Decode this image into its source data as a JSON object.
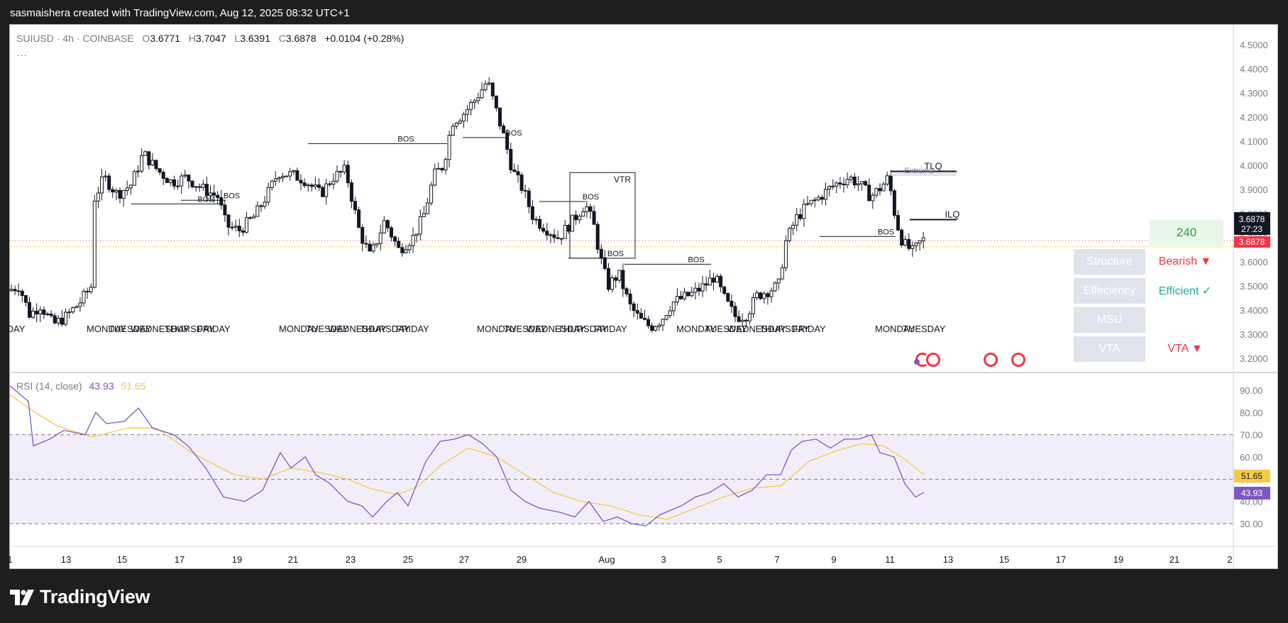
{
  "header": {
    "attribution": "sasmaishera created with TradingView.com, Aug 12, 2025 08:32 UTC+1"
  },
  "legend": {
    "symbol": "SUIUSD · 4h · COINBASE",
    "open_label": "O",
    "open": "3.6771",
    "high_label": "H",
    "high": "3.7047",
    "low_label": "L",
    "low": "3.6391",
    "close_label": "C",
    "close": "3.6878",
    "change": "+0.0104 (+0.28%)",
    "more": "..."
  },
  "rsi_legend": {
    "label": "RSI (14, close)",
    "rsi": "43.93",
    "ma": "51.65"
  },
  "price_badge": {
    "price": "3.6878",
    "countdown": "27:23",
    "close": "3.6878"
  },
  "rsi_badges": {
    "ma": "51.65",
    "rsi": "43.93"
  },
  "panel": {
    "timeframe": "240",
    "rows": [
      {
        "label": "Structure",
        "value": "Bearish ▼",
        "color": "#f23645"
      },
      {
        "label": "Effeciency",
        "value": "Efficient ✓",
        "color": "#22ab94"
      },
      {
        "label": "MSU",
        "value": "",
        "color": "#22ab94"
      },
      {
        "label": "VTA",
        "value": "VTA ▼",
        "color": "#f23645"
      }
    ]
  },
  "footer": {
    "brand": "TradingView"
  },
  "chart_data": [
    {
      "type": "candlestick",
      "title": "SUIUSD · 4h · COINBASE",
      "ylim": [
        3.15,
        4.55
      ],
      "yticks": [
        "4.5000",
        "4.4000",
        "4.3000",
        "4.2000",
        "4.1000",
        "4.0000",
        "3.9000",
        "3.8000",
        "3.7000",
        "3.6000",
        "3.5000",
        "3.4000",
        "3.3000",
        "3.2000"
      ],
      "xticks": [
        "1",
        "13",
        "15",
        "17",
        "19",
        "21",
        "23",
        "25",
        "27",
        "29",
        "Aug",
        "3",
        "5",
        "7",
        "9",
        "11",
        "13",
        "15",
        "17",
        "19",
        "21",
        "2"
      ],
      "day_labels": [
        {
          "x": 6,
          "t": "IDAY"
        },
        {
          "x": 122,
          "t": "MONDAY"
        },
        {
          "x": 153,
          "t": "TUESDAY"
        },
        {
          "x": 184,
          "t": "WEDNESDAY"
        },
        {
          "x": 232,
          "t": "THURSDAY"
        },
        {
          "x": 278,
          "t": "FRIDAY"
        },
        {
          "x": 393,
          "t": "MONDAY"
        },
        {
          "x": 431,
          "t": "TUESDAY"
        },
        {
          "x": 462,
          "t": "WEDNESDAY"
        },
        {
          "x": 507,
          "t": "THURSDAY"
        },
        {
          "x": 558,
          "t": "FRIDAY"
        },
        {
          "x": 672,
          "t": "MONDAY"
        },
        {
          "x": 710,
          "t": "TUESDAY"
        },
        {
          "x": 742,
          "t": "WEDNESDAY"
        },
        {
          "x": 786,
          "t": "THURSDAY"
        },
        {
          "x": 837,
          "t": "FRIDAY"
        },
        {
          "x": 953,
          "t": "MONDAY"
        },
        {
          "x": 993,
          "t": "TUESDAY"
        },
        {
          "x": 1025,
          "t": "WEDNESDAY"
        },
        {
          "x": 1070,
          "t": "THURSDAY"
        },
        {
          "x": 1117,
          "t": "FRIDAY"
        },
        {
          "x": 1233,
          "t": "MONDAY"
        },
        {
          "x": 1272,
          "t": "TUESDAY"
        }
      ],
      "annotations": [
        {
          "type": "bos",
          "label": "BOS",
          "x1": 185,
          "x2": 315,
          "price": 3.84
        },
        {
          "type": "bos",
          "label": "BOS",
          "x1": 255,
          "x2": 318,
          "price": 3.855
        },
        {
          "type": "bos",
          "label": "BOS",
          "x1": 434,
          "x2": 630,
          "price": 4.09
        },
        {
          "type": "bos",
          "label": "BOS",
          "x1": 652,
          "x2": 716,
          "price": 4.115
        },
        {
          "type": "bos",
          "label": "BOS",
          "x1": 760,
          "x2": 825,
          "price": 3.85
        },
        {
          "type": "bos",
          "label": "BOS",
          "x1": 801,
          "x2": 854,
          "price": 3.615
        },
        {
          "type": "bos",
          "label": "BOS",
          "x1": 880,
          "x2": 1002,
          "price": 3.59
        },
        {
          "type": "bos",
          "label": "BOS",
          "x1": 1155,
          "x2": 1262,
          "price": 3.705
        },
        {
          "type": "vtr",
          "label": "VTR",
          "x1": 803,
          "x2": 895,
          "p_top": 3.97,
          "p_bot": 3.615
        },
        {
          "type": "line",
          "label": "TLQ",
          "x1": 1255,
          "x2": 1348,
          "price": 3.975
        },
        {
          "type": "zone",
          "label": "Extreme",
          "x1": 1255,
          "x2": 1348,
          "p_top": 3.97,
          "p_bot": 3.96
        },
        {
          "type": "line",
          "label": "ILQ",
          "x1": 1282,
          "x2": 1348,
          "price": 3.775
        }
      ],
      "last_price": 3.6878
    },
    {
      "type": "line",
      "title": "RSI (14, close)",
      "ylim": [
        25,
        95
      ],
      "yticks": [
        "90.00",
        "80.00",
        "70.00",
        "60.00",
        "50.00",
        "40.00",
        "30.00"
      ],
      "band": [
        30,
        70
      ],
      "series": [
        {
          "name": "RSI",
          "color": "#7e57c2",
          "last": 43.93
        },
        {
          "name": "RSI-based MA",
          "color": "#f7c948",
          "last": 51.65
        }
      ]
    }
  ]
}
